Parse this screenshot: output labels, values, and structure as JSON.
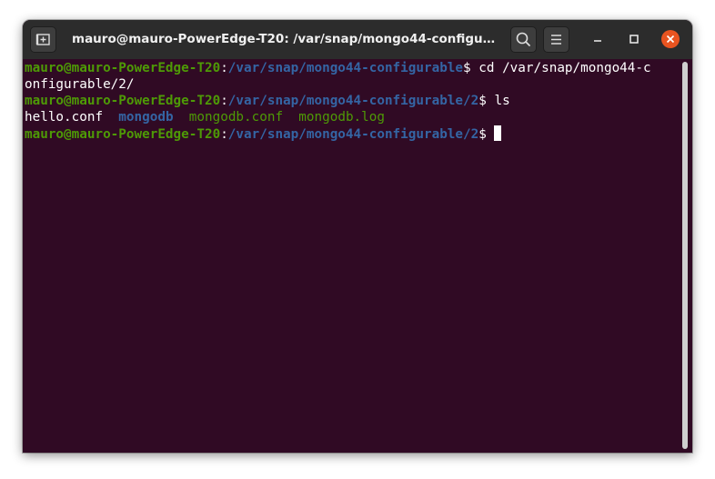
{
  "window": {
    "title": "mauro@mauro-PowerEdge-T20: /var/snap/mongo44-configurabl..."
  },
  "titlebar": {
    "newtab_icon": "new-tab-icon",
    "search_icon": "search-icon",
    "menu_icon": "hamburger-menu-icon",
    "minimize_icon": "minimize-icon",
    "maximize_icon": "maximize-icon",
    "close_icon": "close-icon"
  },
  "colors": {
    "terminal_bg": "#300a24",
    "titlebar_bg": "#2c2c2c",
    "prompt_user": "#4e9a06",
    "prompt_path": "#3465a4",
    "close_button": "#e95420"
  },
  "terminal": {
    "prompt_user_host": "mauro@mauro-PowerEdge-T20",
    "sep": ":",
    "dollar": "$",
    "lines": [
      {
        "path": "/var/snap/mongo44-configurable",
        "command": " cd /var/snap/mongo44-c"
      },
      {
        "continuation": "onfigurable/2/"
      },
      {
        "path": "/var/snap/mongo44-configurable/2",
        "command": " ls"
      },
      {
        "ls_items": [
          "hello.conf",
          "mongodb",
          "mongodb.conf",
          "mongodb.log"
        ]
      },
      {
        "path": "/var/snap/mongo44-configurable/2",
        "command": " "
      }
    ]
  }
}
